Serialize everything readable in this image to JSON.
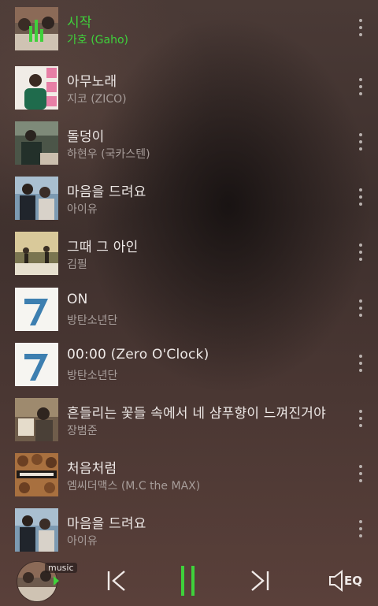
{
  "colors": {
    "playing": "#3fd13b",
    "text": "#ede8e6",
    "subtext": "#a79d9a"
  },
  "tracks": [
    {
      "title": "시작",
      "artist": "가호 (Gaho)",
      "playing": true
    },
    {
      "title": "아무노래",
      "artist": "지코 (ZICO)",
      "playing": false
    },
    {
      "title": "돌덩이",
      "artist": "하현우 (국카스텐)",
      "playing": false
    },
    {
      "title": "마음을 드려요",
      "artist": "아이유",
      "playing": false
    },
    {
      "title": "그때 그 아인",
      "artist": "김필",
      "playing": false
    },
    {
      "title": "ON",
      "artist": "방탄소년단",
      "playing": false
    },
    {
      "title": "00:00 (Zero O'Clock)",
      "artist": "방탄소년단",
      "playing": false
    },
    {
      "title": "흔들리는 꽃들 속에서 네 샴푸향이 느껴진거야",
      "artist": "장범준",
      "playing": false
    },
    {
      "title": "처음처럼",
      "artist": "엠씨더맥스 (M.C the MAX)",
      "playing": false
    },
    {
      "title": "마음을 드려요",
      "artist": "아이유",
      "playing": false
    }
  ],
  "player": {
    "tag": "music",
    "eq_label": "EQ",
    "controls": [
      "previous-icon",
      "pause-icon",
      "next-icon",
      "speaker-icon"
    ]
  }
}
